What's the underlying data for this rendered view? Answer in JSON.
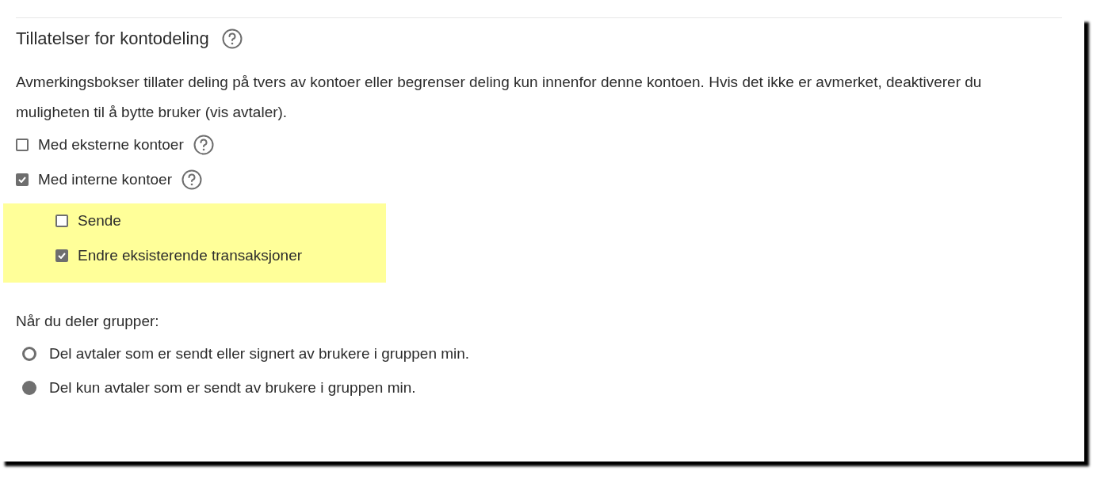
{
  "section": {
    "title": "Tillatelser for kontodeling",
    "description": "Avmerkingsbokser tillater deling på tvers av kontoer eller begrenser deling kun innenfor denne kontoen. Hvis det ikke er avmerket, deaktiverer du muligheten til å bytte bruker (vis avtaler)."
  },
  "account_options": [
    {
      "label": "Med eksterne kontoer",
      "checked": false
    },
    {
      "label": "Med interne kontoer",
      "checked": true
    }
  ],
  "sub_options": {
    "highlighted": true,
    "items": [
      {
        "label": "Sende",
        "checked": false
      },
      {
        "label": "Endre eksisterende transaksjoner",
        "checked": true
      }
    ]
  },
  "group_sharing": {
    "label": "Når du deler grupper:",
    "options": [
      {
        "label": "Del avtaler som er sendt eller signert av brukere i gruppen min.",
        "selected": false
      },
      {
        "label": "Del kun avtaler som er sendt av brukere i gruppen min.",
        "selected": true
      }
    ]
  }
}
